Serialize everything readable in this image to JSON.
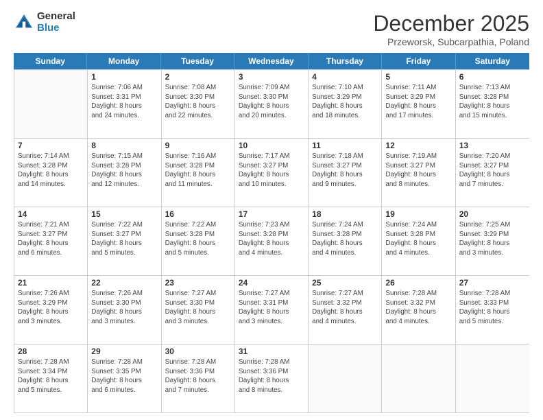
{
  "header": {
    "logo_general": "General",
    "logo_blue": "Blue",
    "month_title": "December 2025",
    "subtitle": "Przeworsk, Subcarpathia, Poland"
  },
  "weekdays": [
    "Sunday",
    "Monday",
    "Tuesday",
    "Wednesday",
    "Thursday",
    "Friday",
    "Saturday"
  ],
  "weeks": [
    [
      {
        "day": "",
        "info": ""
      },
      {
        "day": "1",
        "info": "Sunrise: 7:06 AM\nSunset: 3:31 PM\nDaylight: 8 hours\nand 24 minutes."
      },
      {
        "day": "2",
        "info": "Sunrise: 7:08 AM\nSunset: 3:30 PM\nDaylight: 8 hours\nand 22 minutes."
      },
      {
        "day": "3",
        "info": "Sunrise: 7:09 AM\nSunset: 3:30 PM\nDaylight: 8 hours\nand 20 minutes."
      },
      {
        "day": "4",
        "info": "Sunrise: 7:10 AM\nSunset: 3:29 PM\nDaylight: 8 hours\nand 18 minutes."
      },
      {
        "day": "5",
        "info": "Sunrise: 7:11 AM\nSunset: 3:29 PM\nDaylight: 8 hours\nand 17 minutes."
      },
      {
        "day": "6",
        "info": "Sunrise: 7:13 AM\nSunset: 3:28 PM\nDaylight: 8 hours\nand 15 minutes."
      }
    ],
    [
      {
        "day": "7",
        "info": "Sunrise: 7:14 AM\nSunset: 3:28 PM\nDaylight: 8 hours\nand 14 minutes."
      },
      {
        "day": "8",
        "info": "Sunrise: 7:15 AM\nSunset: 3:28 PM\nDaylight: 8 hours\nand 12 minutes."
      },
      {
        "day": "9",
        "info": "Sunrise: 7:16 AM\nSunset: 3:28 PM\nDaylight: 8 hours\nand 11 minutes."
      },
      {
        "day": "10",
        "info": "Sunrise: 7:17 AM\nSunset: 3:27 PM\nDaylight: 8 hours\nand 10 minutes."
      },
      {
        "day": "11",
        "info": "Sunrise: 7:18 AM\nSunset: 3:27 PM\nDaylight: 8 hours\nand 9 minutes."
      },
      {
        "day": "12",
        "info": "Sunrise: 7:19 AM\nSunset: 3:27 PM\nDaylight: 8 hours\nand 8 minutes."
      },
      {
        "day": "13",
        "info": "Sunrise: 7:20 AM\nSunset: 3:27 PM\nDaylight: 8 hours\nand 7 minutes."
      }
    ],
    [
      {
        "day": "14",
        "info": "Sunrise: 7:21 AM\nSunset: 3:27 PM\nDaylight: 8 hours\nand 6 minutes."
      },
      {
        "day": "15",
        "info": "Sunrise: 7:22 AM\nSunset: 3:27 PM\nDaylight: 8 hours\nand 5 minutes."
      },
      {
        "day": "16",
        "info": "Sunrise: 7:22 AM\nSunset: 3:28 PM\nDaylight: 8 hours\nand 5 minutes."
      },
      {
        "day": "17",
        "info": "Sunrise: 7:23 AM\nSunset: 3:28 PM\nDaylight: 8 hours\nand 4 minutes."
      },
      {
        "day": "18",
        "info": "Sunrise: 7:24 AM\nSunset: 3:28 PM\nDaylight: 8 hours\nand 4 minutes."
      },
      {
        "day": "19",
        "info": "Sunrise: 7:24 AM\nSunset: 3:28 PM\nDaylight: 8 hours\nand 4 minutes."
      },
      {
        "day": "20",
        "info": "Sunrise: 7:25 AM\nSunset: 3:29 PM\nDaylight: 8 hours\nand 3 minutes."
      }
    ],
    [
      {
        "day": "21",
        "info": "Sunrise: 7:26 AM\nSunset: 3:29 PM\nDaylight: 8 hours\nand 3 minutes."
      },
      {
        "day": "22",
        "info": "Sunrise: 7:26 AM\nSunset: 3:30 PM\nDaylight: 8 hours\nand 3 minutes."
      },
      {
        "day": "23",
        "info": "Sunrise: 7:27 AM\nSunset: 3:30 PM\nDaylight: 8 hours\nand 3 minutes."
      },
      {
        "day": "24",
        "info": "Sunrise: 7:27 AM\nSunset: 3:31 PM\nDaylight: 8 hours\nand 3 minutes."
      },
      {
        "day": "25",
        "info": "Sunrise: 7:27 AM\nSunset: 3:32 PM\nDaylight: 8 hours\nand 4 minutes."
      },
      {
        "day": "26",
        "info": "Sunrise: 7:28 AM\nSunset: 3:32 PM\nDaylight: 8 hours\nand 4 minutes."
      },
      {
        "day": "27",
        "info": "Sunrise: 7:28 AM\nSunset: 3:33 PM\nDaylight: 8 hours\nand 5 minutes."
      }
    ],
    [
      {
        "day": "28",
        "info": "Sunrise: 7:28 AM\nSunset: 3:34 PM\nDaylight: 8 hours\nand 5 minutes."
      },
      {
        "day": "29",
        "info": "Sunrise: 7:28 AM\nSunset: 3:35 PM\nDaylight: 8 hours\nand 6 minutes."
      },
      {
        "day": "30",
        "info": "Sunrise: 7:28 AM\nSunset: 3:36 PM\nDaylight: 8 hours\nand 7 minutes."
      },
      {
        "day": "31",
        "info": "Sunrise: 7:28 AM\nSunset: 3:36 PM\nDaylight: 8 hours\nand 8 minutes."
      },
      {
        "day": "",
        "info": ""
      },
      {
        "day": "",
        "info": ""
      },
      {
        "day": "",
        "info": ""
      }
    ]
  ]
}
